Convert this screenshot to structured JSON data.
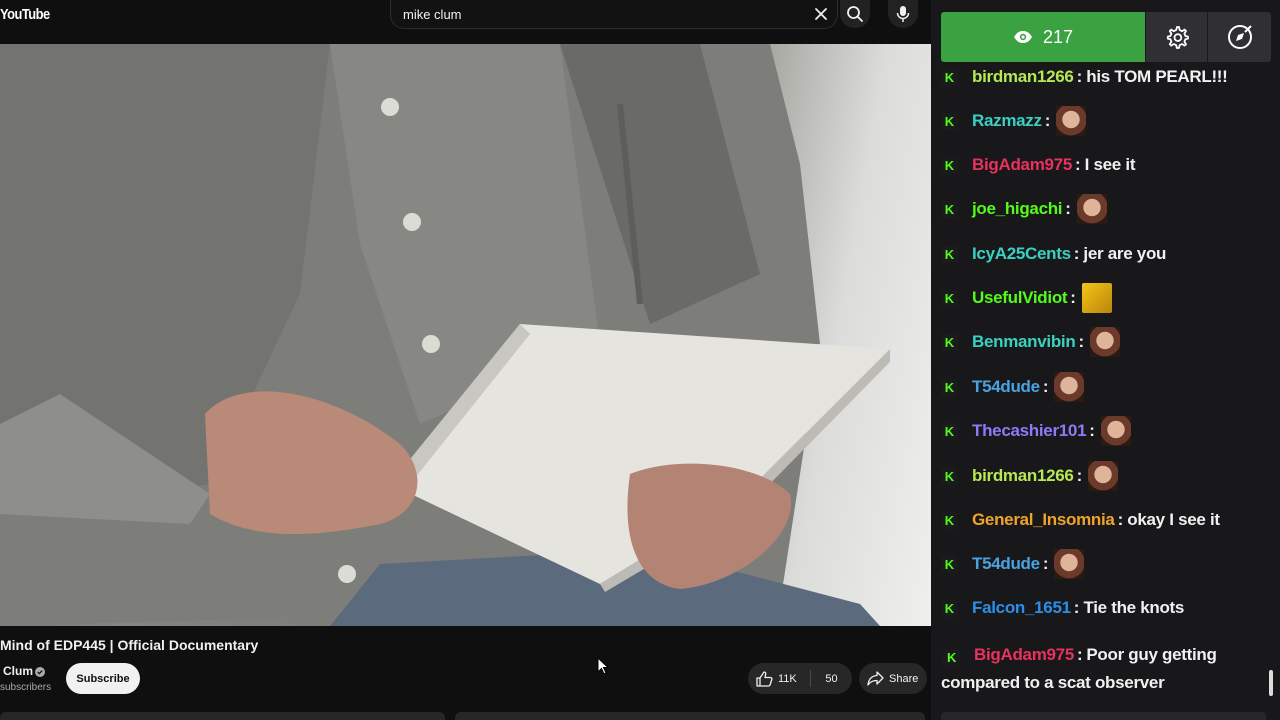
{
  "youtube": {
    "logo_text": "YouTube",
    "search": {
      "query": "mike clum"
    },
    "video": {
      "title": "Mind of EDP445 | Official Documentary",
      "channel": "Clum",
      "subscribers_text": "subscribers",
      "subscribe_label": "Subscribe",
      "likes": "11K",
      "dislike_count": "50",
      "share_label": "Share"
    }
  },
  "chat": {
    "viewer_count": "217",
    "accent_color": "#53fc18",
    "badge_glyph": "K",
    "messages": [
      {
        "user": "birdman1266",
        "color": "#b5e853",
        "text": "his TOM PEARL!!!"
      },
      {
        "user": "Razmazz",
        "color": "#3ad0c2",
        "emote": "face-emote"
      },
      {
        "user": "BigAdam975",
        "color": "#e8315c",
        "text": "I see it"
      },
      {
        "user": "joe_higachi",
        "color": "#53fc18",
        "emote": "face-emote"
      },
      {
        "user": "IcyA25Cents",
        "color": "#3ad0c2",
        "text": "jer are you"
      },
      {
        "user": "UsefulVidiot",
        "color": "#53fc18",
        "emote": "gold-emote"
      },
      {
        "user": "Benmanvibin",
        "color": "#3ad0c2",
        "emote": "face-emote"
      },
      {
        "user": "T54dude",
        "color": "#4aa3e0",
        "emote": "face-emote"
      },
      {
        "user": "Thecashier101",
        "color": "#8b7cf6",
        "emote": "face-emote"
      },
      {
        "user": "birdman1266",
        "color": "#b5e853",
        "emote": "face-emote"
      },
      {
        "user": "General_Insomnia",
        "color": "#f0a32c",
        "text": "okay I see it"
      },
      {
        "user": "T54dude",
        "color": "#4aa3e0",
        "emote": "face-emote"
      },
      {
        "user": "Falcon_1651",
        "color": "#2b8fe8",
        "text": "Tie the knots"
      },
      {
        "user": "BigAdam975",
        "color": "#e8315c",
        "text": "Poor guy getting compared to a scat observer"
      }
    ]
  }
}
